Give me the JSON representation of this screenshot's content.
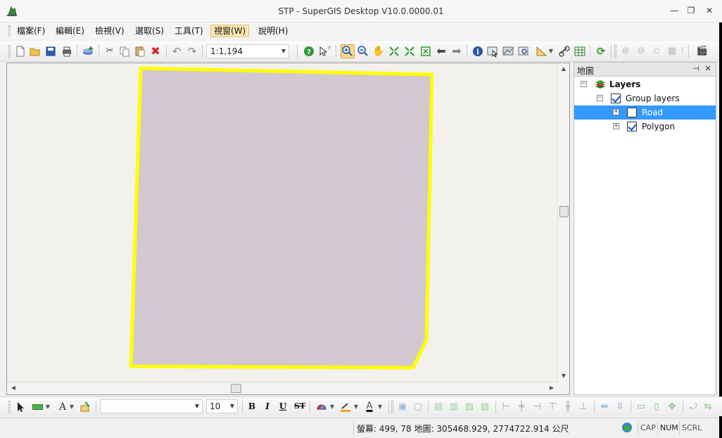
{
  "window": {
    "title": "STP - SuperGIS Desktop V10.0.0000.01",
    "minimize_glyph": "—",
    "restore_glyph": "❐",
    "close_glyph": "✕"
  },
  "menu": [
    {
      "label": "檔案(F)"
    },
    {
      "label": "編輯(E)"
    },
    {
      "label": "檢視(V)"
    },
    {
      "label": "選取(S)"
    },
    {
      "label": "工具(T)"
    },
    {
      "label": "視窗(W)"
    },
    {
      "label": "說明(H)"
    }
  ],
  "toolbar": {
    "scale_value": "1:1,194",
    "tools": [
      "new-file",
      "open-folder",
      "save",
      "print",
      "add-data",
      "cut",
      "copy",
      "paste",
      "delete",
      "undo",
      "redo",
      "help",
      "what-is-this",
      "zoom-in",
      "zoom-out",
      "pan",
      "full-extent",
      "fixed-zoom-in",
      "fixed-zoom-out",
      "back",
      "forward",
      "identify",
      "select-features",
      "map-tips",
      "find",
      "measure",
      "hyperlink",
      "attribute-table",
      "refresh"
    ]
  },
  "map": {
    "polygon_fill": "#d3c8d0",
    "polygon_outline": "#ffff00",
    "background": "#f2f1ed"
  },
  "layers_panel": {
    "title": "地圖",
    "pin_glyph": "⊣",
    "close_glyph": "✕",
    "root": {
      "label": "Layers",
      "expander": "−"
    },
    "group": {
      "label": "Group layers",
      "expander": "−",
      "checked": true
    },
    "layers": [
      {
        "label": "Road",
        "expander": "+",
        "checked": false,
        "selected": true
      },
      {
        "label": "Polygon",
        "expander": "+",
        "checked": true,
        "selected": false
      }
    ]
  },
  "drawing_toolbar": {
    "font_name": "",
    "font_size": "10",
    "bold": "B",
    "italic": "I",
    "underline": "U",
    "strikethrough": "ST",
    "text_tool": "A",
    "font_color": "A"
  },
  "statusbar": {
    "coords": "螢幕: 499, 78   地圖: 305468.929, 2774722.914 公尺",
    "cap": "CAP",
    "num": "NUM",
    "scrl": "SCRL"
  }
}
